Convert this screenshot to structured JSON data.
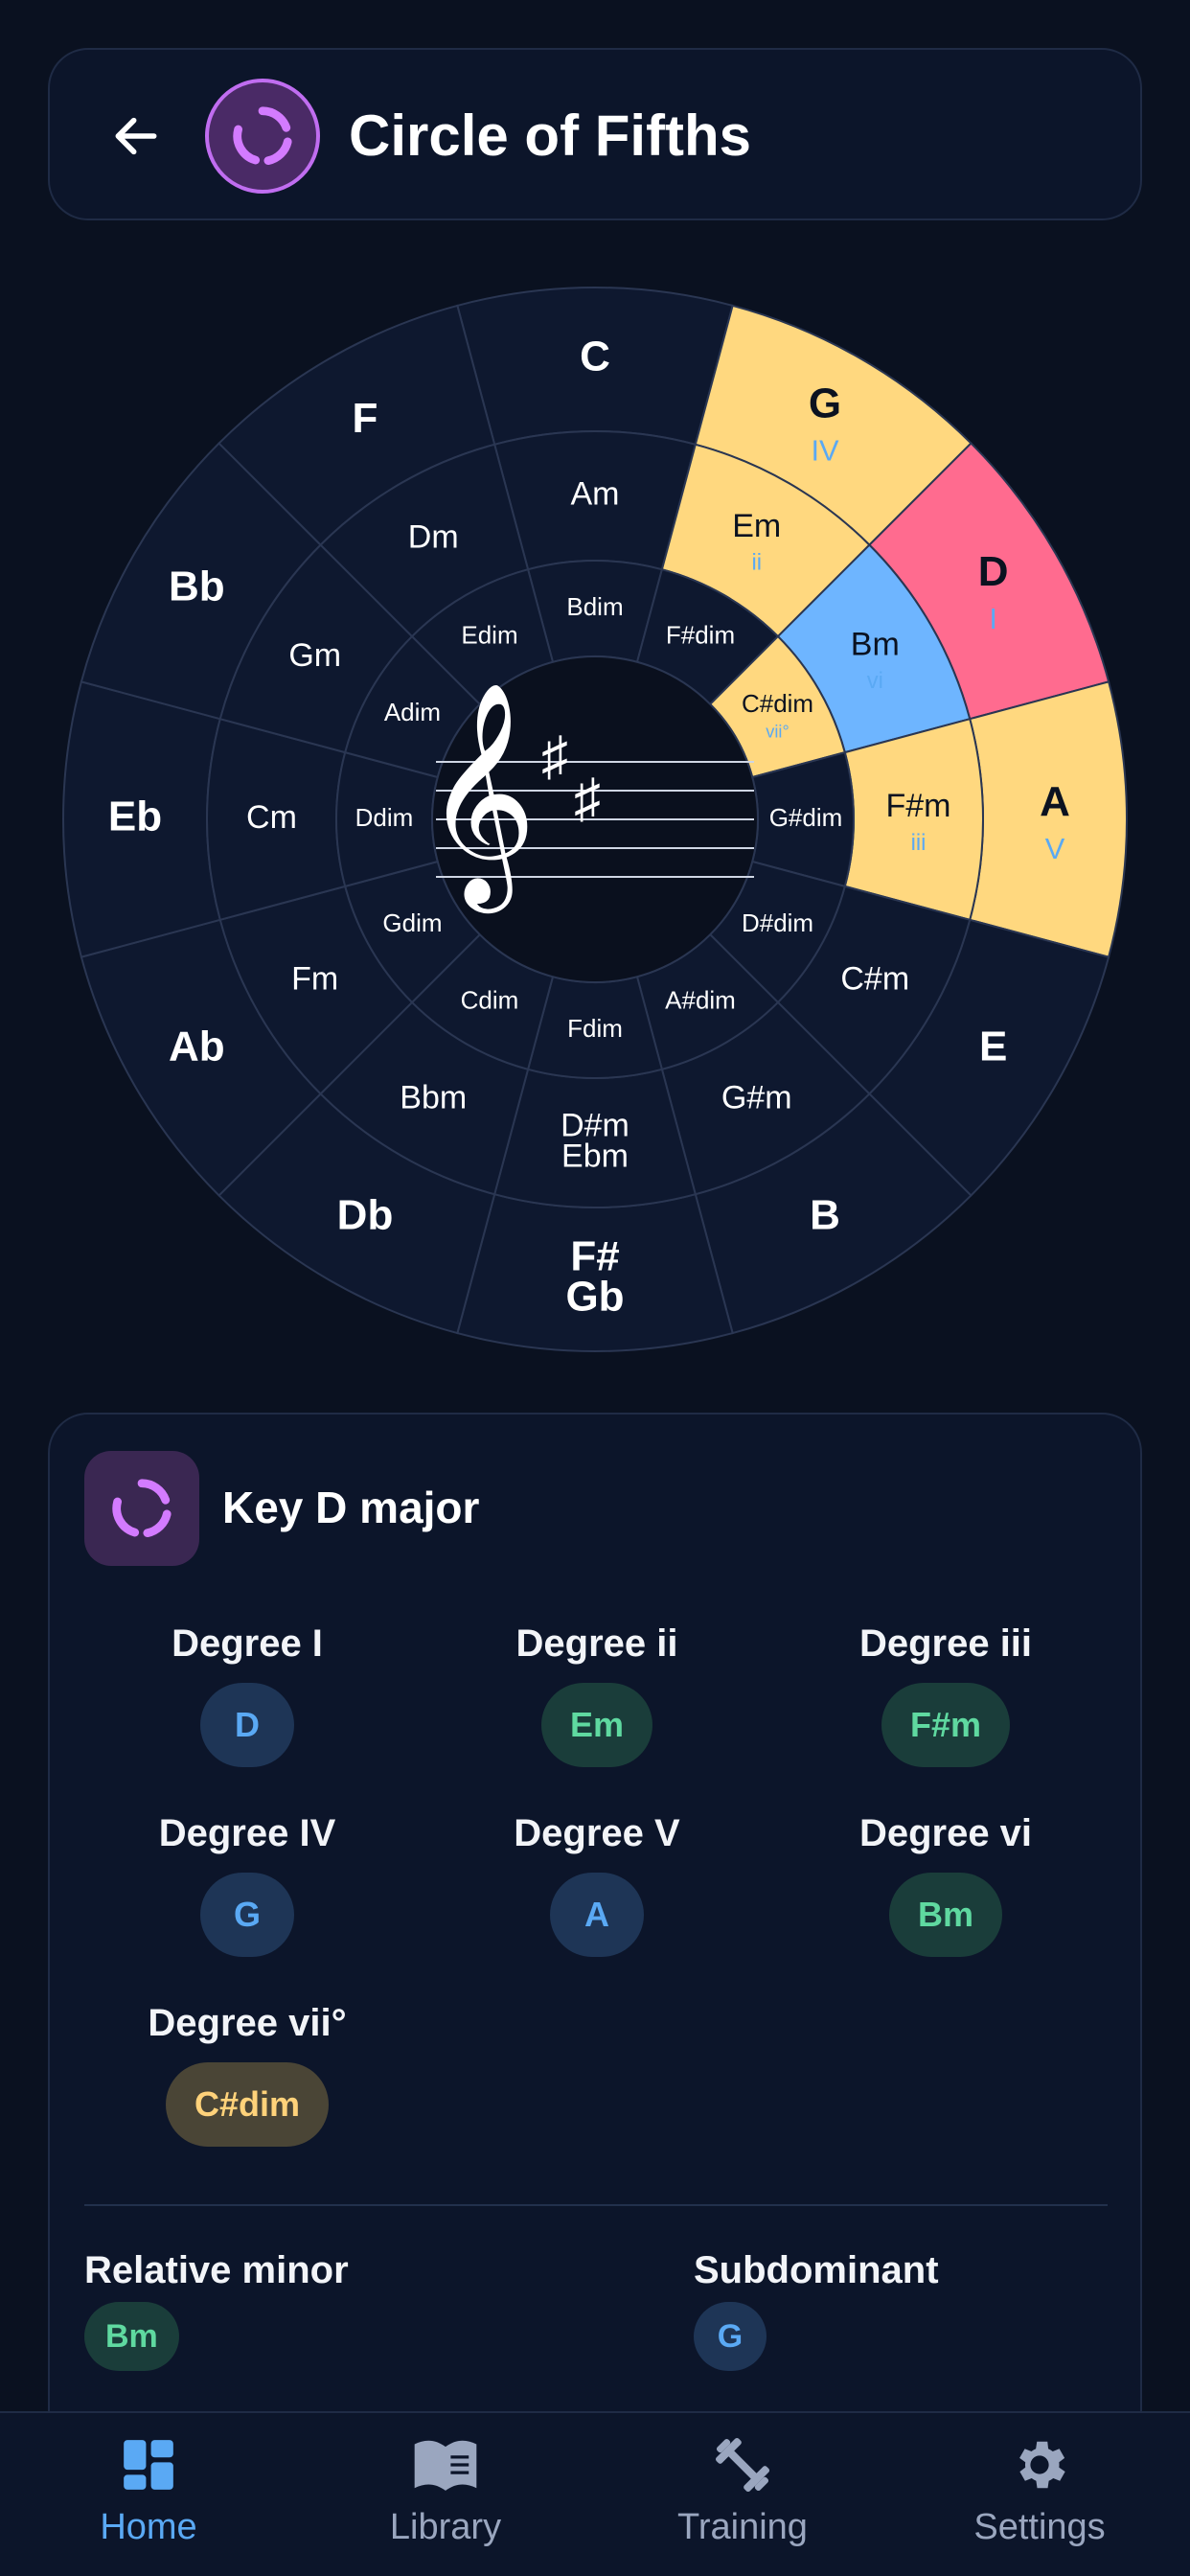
{
  "header": {
    "title": "Circle of Fifths",
    "back_icon": "arrow-left-icon",
    "logo_icon": "circle-arrows-icon"
  },
  "wheel": {
    "major": [
      "C",
      "G",
      "D",
      "A",
      "E",
      "B",
      "F#\nGb",
      "Db",
      "Ab",
      "Eb",
      "Bb",
      "F"
    ],
    "minor": [
      "Am",
      "Em",
      "Bm",
      "F#m",
      "C#m",
      "G#m",
      "D#m\nEbm",
      "Bbm",
      "Fm",
      "Cm",
      "Gm",
      "Dm"
    ],
    "dim": [
      "Bdim",
      "F#dim",
      "C#dim",
      "G#dim",
      "D#dim",
      "A#dim",
      "Fdim",
      "Cdim",
      "Gdim",
      "Ddim",
      "Adim",
      "Edim"
    ],
    "highlights": {
      "major": {
        "1": {
          "numeral": "IV",
          "color": "#ffd87f"
        },
        "2": {
          "numeral": "I",
          "color": "#ff6b8f"
        },
        "3": {
          "numeral": "V",
          "color": "#ffd87f"
        }
      },
      "minor": {
        "1": {
          "numeral": "ii",
          "color": "#ffd87f"
        },
        "2": {
          "numeral": "vi",
          "color": "#6eb5ff"
        },
        "3": {
          "numeral": "iii",
          "color": "#ffd87f"
        }
      },
      "dim": {
        "2": {
          "numeral": "vii°",
          "color": "#ffd87f"
        }
      }
    },
    "colors": {
      "base": "#0e182f",
      "line": "#2a3652",
      "center": "#0a101e",
      "numeral": "#5aa9f4"
    },
    "center": {
      "clef": "𝄞",
      "sharps": [
        "♯",
        "♯"
      ]
    }
  },
  "key_card": {
    "title": "Key D major",
    "icon": "circle-arrows-icon",
    "degrees": [
      {
        "label": "Degree I",
        "chord": "D",
        "style": "blue"
      },
      {
        "label": "Degree ii",
        "chord": "Em",
        "style": "green"
      },
      {
        "label": "Degree iii",
        "chord": "F#m",
        "style": "green"
      },
      {
        "label": "Degree IV",
        "chord": "G",
        "style": "blue"
      },
      {
        "label": "Degree V",
        "chord": "A",
        "style": "blue"
      },
      {
        "label": "Degree vi",
        "chord": "Bm",
        "style": "green"
      },
      {
        "label": "Degree vii°",
        "chord": "C#dim",
        "style": "yellow"
      }
    ],
    "relative_minor": {
      "label": "Relative minor",
      "chord": "Bm"
    },
    "subdominant": {
      "label": "Subdominant",
      "chord": "G"
    }
  },
  "nav": {
    "items": [
      {
        "label": "Home",
        "icon": "dashboard-icon"
      },
      {
        "label": "Library",
        "icon": "book-icon"
      },
      {
        "label": "Training",
        "icon": "dumbbell-icon"
      },
      {
        "label": "Settings",
        "icon": "gear-icon"
      }
    ],
    "active_color": "#5aa9f4"
  }
}
